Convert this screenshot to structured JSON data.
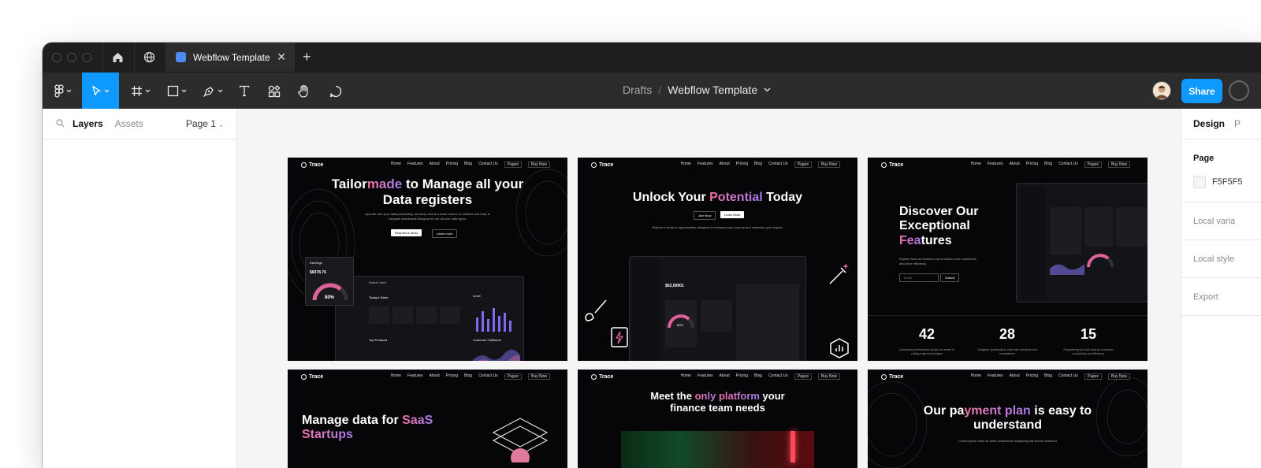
{
  "titlebar": {
    "tab_title": "Webflow Template",
    "tab_close_icon": "close-icon",
    "new_tab_icon": "plus-icon",
    "home_icon": "home-icon",
    "globe_icon": "globe-icon"
  },
  "toolbar": {
    "tools": [
      "figma-menu",
      "move",
      "frame",
      "shape",
      "pen",
      "text",
      "resources",
      "hand",
      "comment"
    ],
    "breadcrumb_root": "Drafts",
    "breadcrumb_separator": "/",
    "file_name": "Webflow Template",
    "share_label": "Share",
    "accent_color": "#0d99ff"
  },
  "left_panel": {
    "tab_layers": "Layers",
    "tab_assets": "Assets",
    "page_selector": "Page 1"
  },
  "right_panel": {
    "tab_design": "Design",
    "tab_prototype": "P",
    "page_label": "Page",
    "page_color": "F5F5F5",
    "local_variables": "Local varia",
    "local_styles": "Local style",
    "export": "Export"
  },
  "frames": {
    "nav": {
      "logo": "Trace",
      "links": [
        "Home",
        "Features",
        "About",
        "Pricing",
        "Blog",
        "Contact Us"
      ],
      "pages": "Pages",
      "buy": "Buy Now"
    },
    "f1": {
      "h_part1": "Tailor",
      "h_grad": "made",
      "h_part2": " to Manage all your",
      "h_line2": "Data registers",
      "sub": "Operate with your data predictably, securely, and at a lower cost in an intuitive and easy to navigate dashboard.Designed to run all your data types.",
      "btn1": "Request a demo",
      "btn2": "Learn more",
      "earnings_label": "Earnings",
      "earnings_value": "$6078.76",
      "gauge": "80%",
      "todays_sales": "Today's Sales",
      "level": "Level",
      "top_products": "Top Products",
      "customer_fulfilment": "Customer Fulfilment"
    },
    "f2": {
      "h_part1": "Unlock Your ",
      "h_grad": "Potential",
      "h_part2": " Today",
      "btn1": "Join Now",
      "btn2": "Learn More",
      "sub": "Explore a world of opportunities designed to enhance your journey and maximize your impact.",
      "balance": "$53,00901",
      "gauge": "80%"
    },
    "f3": {
      "h_line1": "Discover Our",
      "h_line2": "Exceptional",
      "h_grad": "Fea",
      "h_tail": "tures",
      "sub": "Explore how our features can enhance your experience and drive efficiency.",
      "email": "Email",
      "submit": "Submit",
      "stats": [
        {
          "num": "42",
          "desc": "Unmatched performance across our series of cutting-edge technologies"
        },
        {
          "num": "28",
          "desc": "Designed specifically to meet user demands and expectations"
        },
        {
          "num": "15",
          "desc": "Empowering you with tools for enhanced productivity and efficiency"
        }
      ]
    },
    "f4": {
      "h_line1a": "Manage data for ",
      "h_grad1": "SaaS",
      "h_grad2": "Startups"
    },
    "f5": {
      "h_part1": "Meet the ",
      "h_grad1": "only ",
      "h_grad2": "platform",
      "h_part2": " your",
      "h_line2": "finance team needs"
    },
    "f6": {
      "h_part1": "Our pa",
      "h_grad": "yment plan",
      "h_part2": " is easy to",
      "h_line2": "understand",
      "sub": "Lorem ipsum dolor sit amet consectetur adipiscing elit sed do eiusmod"
    }
  }
}
